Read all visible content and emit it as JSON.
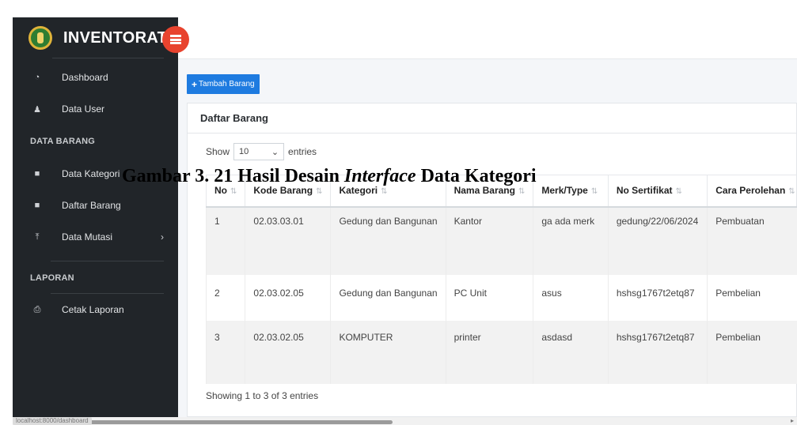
{
  "app": {
    "brand": "INVENTORAT"
  },
  "sidebar": {
    "items": [
      {
        "icon": "dashboard-icon",
        "label": "Dashboard"
      },
      {
        "icon": "user-icon",
        "label": "Data User"
      }
    ],
    "sections": [
      {
        "title": "DATA BARANG",
        "items": [
          {
            "icon": "briefcase-icon",
            "label": "Data Kategori"
          },
          {
            "icon": "briefcase-icon",
            "label": "Daftar Barang"
          },
          {
            "icon": "upload-icon",
            "label": "Data Mutasi"
          }
        ]
      },
      {
        "title": "LAPORAN",
        "items": [
          {
            "icon": "printer-icon",
            "label": "Cetak Laporan"
          }
        ]
      }
    ]
  },
  "toolbar": {
    "add_label": "Tambah Barang"
  },
  "card": {
    "title": "Daftar Barang"
  },
  "length": {
    "show": "Show",
    "value": "10",
    "entries": "entries"
  },
  "table": {
    "columns": [
      "No",
      "Kode Barang",
      "Kategori",
      "Nama Barang",
      "Merk/Type",
      "No Sertifikat",
      "Cara Perolehan"
    ],
    "rows": [
      [
        "1",
        "02.03.03.01",
        "Gedung dan Bangunan",
        "Kantor",
        "ga ada merk",
        "gedung/22/06/2024",
        "Pembuatan"
      ],
      [
        "2",
        "02.03.02.05",
        "Gedung dan Bangunan",
        "PC Unit",
        "asus",
        "hshsg1767t2etq87",
        "Pembelian"
      ],
      [
        "3",
        "02.03.02.05",
        "KOMPUTER",
        "printer",
        "asdasd",
        "hshsg1767t2etq87",
        "Pembelian"
      ]
    ]
  },
  "info": "Showing 1 to 3 of 3 entries",
  "caption": {
    "prefix": "Gambar 3. 21 Hasil Desain ",
    "italic": "Interface",
    "suffix": " Data Kategori"
  },
  "status": {
    "url": "localhost:8000/dashboard"
  },
  "colors": {
    "sidebar": "#212529",
    "accent": "#1e7be0",
    "toggle": "#e8432e"
  }
}
